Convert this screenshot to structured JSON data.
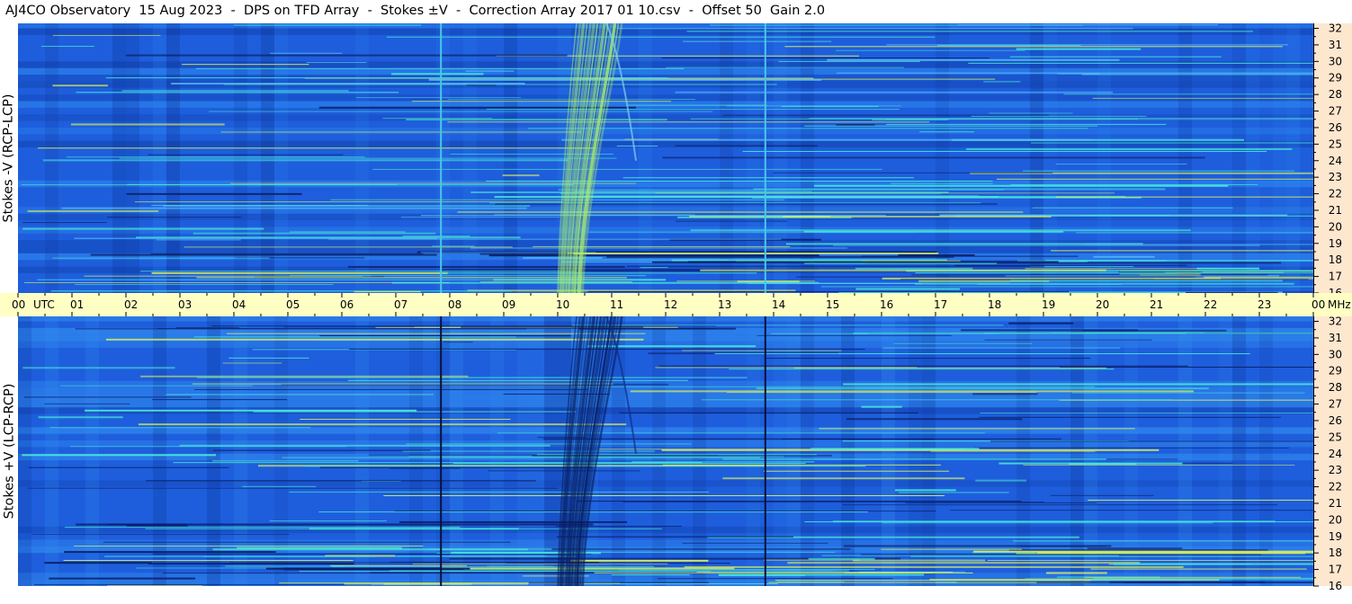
{
  "title": "AJ4CO Observatory  15 Aug 2023  -  DPS on TFD Array  -  Stokes ±V  -  Correction Array 2017 01 10.csv  -  Offset 50  Gain 2.0",
  "chart_data": [
    {
      "type": "heatmap",
      "panel": "top",
      "ylabel": "Stokes -V (RCP-LCP)",
      "x_unit": "UTC",
      "y_unit": "MHz",
      "x_ticks": [
        "00",
        "01",
        "02",
        "03",
        "04",
        "05",
        "06",
        "07",
        "08",
        "09",
        "10",
        "11",
        "12",
        "13",
        "14",
        "15",
        "16",
        "17",
        "18",
        "19",
        "20",
        "21",
        "22",
        "23",
        "00"
      ],
      "xlim": [
        0,
        24
      ],
      "y_ticks": [
        16,
        17,
        18,
        19,
        20,
        21,
        22,
        23,
        24,
        25,
        26,
        27,
        28,
        29,
        30,
        31,
        32
      ],
      "ylim": [
        16,
        32.3
      ],
      "colors": {
        "background": "#1e5edc",
        "light_band": "#2e86f0",
        "dark_band": "#0a2f8e",
        "bright_line": "#48e6d8",
        "hot_line": "#d8f060"
      },
      "features": [
        {
          "kind": "vertical_line",
          "utc": 7.82,
          "color": "#48c8e8"
        },
        {
          "kind": "vertical_line",
          "utc": 13.83,
          "color": "#48c8e8"
        },
        {
          "kind": "burst",
          "utc_start": 10.0,
          "utc_end": 11.0,
          "freq_low": 16,
          "freq_high": 32.3,
          "color": "#a8ec70"
        },
        {
          "kind": "arc",
          "utc_start": 10.9,
          "utc_end": 11.45,
          "freq_low": 24,
          "freq_high": 32.3,
          "color": "#7ed0f0"
        }
      ]
    },
    {
      "type": "heatmap",
      "panel": "bottom",
      "ylabel": "Stokes +V (LCP-RCP)",
      "x_unit": "UTC",
      "y_unit": "MHz",
      "x_ticks": [
        "00",
        "01",
        "02",
        "03",
        "04",
        "05",
        "06",
        "07",
        "08",
        "09",
        "10",
        "11",
        "12",
        "13",
        "14",
        "15",
        "16",
        "17",
        "18",
        "19",
        "20",
        "21",
        "22",
        "23",
        "00"
      ],
      "xlim": [
        0,
        24
      ],
      "y_ticks": [
        16,
        17,
        18,
        19,
        20,
        21,
        22,
        23,
        24,
        25,
        26,
        27,
        28,
        29,
        30,
        31,
        32
      ],
      "ylim": [
        16,
        32.3
      ],
      "colors": {
        "background": "#1e5edc",
        "light_band": "#3390f2",
        "dark_band": "#0a2f8e",
        "bright_line": "#48e6d8",
        "hot_line": "#d8f060"
      },
      "features": [
        {
          "kind": "vertical_line",
          "utc": 7.82,
          "color": "#06123a"
        },
        {
          "kind": "vertical_line",
          "utc": 13.83,
          "color": "#06123a"
        },
        {
          "kind": "burst",
          "utc_start": 10.0,
          "utc_end": 11.0,
          "freq_low": 16,
          "freq_high": 32.3,
          "color": "#081c5a"
        },
        {
          "kind": "arc",
          "utc_start": 10.9,
          "utc_end": 11.45,
          "freq_low": 24,
          "freq_high": 32.3,
          "color": "#0e2e86"
        }
      ]
    }
  ]
}
